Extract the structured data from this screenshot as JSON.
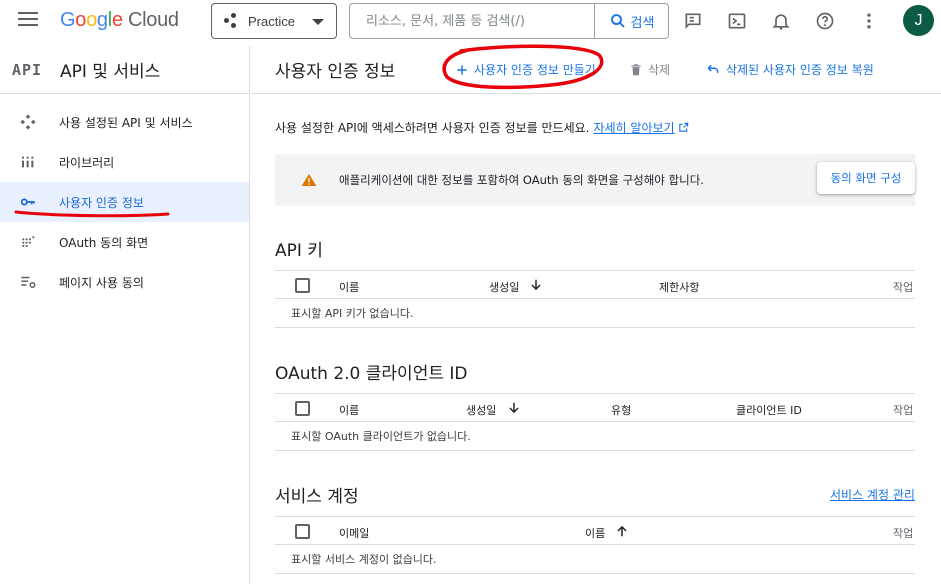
{
  "header": {
    "logo_google": "Google",
    "logo_cloud": "Cloud",
    "project": "Practice",
    "search_placeholder": "리소스, 문서, 제품 등 검색(/)",
    "search_button": "검색",
    "avatar_letter": "J"
  },
  "sidebar": {
    "badge": "API",
    "title": "API 및 서비스",
    "items": [
      {
        "label": "사용 설정된 API 및 서비스",
        "icon": "api-diamond-icon"
      },
      {
        "label": "라이브러리",
        "icon": "library-icon"
      },
      {
        "label": "사용자 인증 정보",
        "icon": "key-icon",
        "active": true
      },
      {
        "label": "OAuth 동의 화면",
        "icon": "oauth-dots-icon"
      },
      {
        "label": "페이지 사용 동의",
        "icon": "page-settings-icon"
      }
    ]
  },
  "main": {
    "title": "사용자 인증 정보",
    "actions": {
      "create": "사용자 인증 정보 만들기",
      "delete": "삭제",
      "restore": "삭제된 사용자 인증 정보 복원"
    },
    "intro_text": "사용 설정한 API에 액세스하려면 사용자 인증 정보를 만드세요.",
    "intro_link": "자세히 알아보기",
    "warning": {
      "text": "애플리케이션에 대한 정보를 포함하여 OAuth 동의 화면을 구성해야 합니다.",
      "button": "동의 화면 구성"
    },
    "api_keys": {
      "title": "API 키",
      "columns": [
        "이름",
        "생성일",
        "제한사항",
        "작업"
      ],
      "empty": "표시할 API 키가 없습니다."
    },
    "oauth_clients": {
      "title": "OAuth 2.0 클라이언트 ID",
      "columns": [
        "이름",
        "생성일",
        "유형",
        "클라이언트 ID",
        "작업"
      ],
      "empty": "표시할 OAuth 클라이언트가 없습니다."
    },
    "service_accounts": {
      "title": "서비스 계정",
      "manage_link": "서비스 계정 관리",
      "columns": [
        "이메일",
        "이름",
        "작업"
      ],
      "empty": "표시할 서비스 계정이 없습니다."
    }
  },
  "colors": {
    "accent": "#1a73e8",
    "annotation_red": "#e8000b",
    "warning": "#e37400",
    "avatar_bg": "#0b5b45",
    "active_bg": "#e8f0fe"
  }
}
